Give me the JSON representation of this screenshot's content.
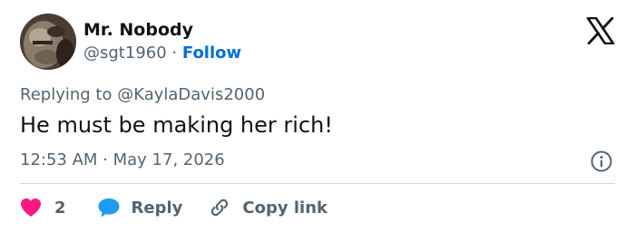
{
  "author": {
    "display_name": "Mr. Nobody",
    "handle": "@sgt1960",
    "separator": "·",
    "follow_label": "Follow"
  },
  "brand": {
    "logo_icon": "x-logo-icon"
  },
  "reply_context": {
    "prefix": "Replying to",
    "mention": "@KaylaDavis2000"
  },
  "tweet": {
    "text": "He must be making her rich!",
    "timestamp": "12:53 AM · May 17, 2026"
  },
  "actions": {
    "like_count": "2",
    "reply_label": "Reply",
    "copy_link_label": "Copy link"
  },
  "colors": {
    "text_primary": "#0f1419",
    "text_secondary": "#536471",
    "accent": "#006fd6",
    "like": "#f91880",
    "reply_icon": "#1d9bf0",
    "divider": "#cfd9de"
  },
  "icons": {
    "like": "heart-icon",
    "reply": "speech-bubble-icon",
    "copy_link": "link-icon",
    "info": "info-icon"
  }
}
